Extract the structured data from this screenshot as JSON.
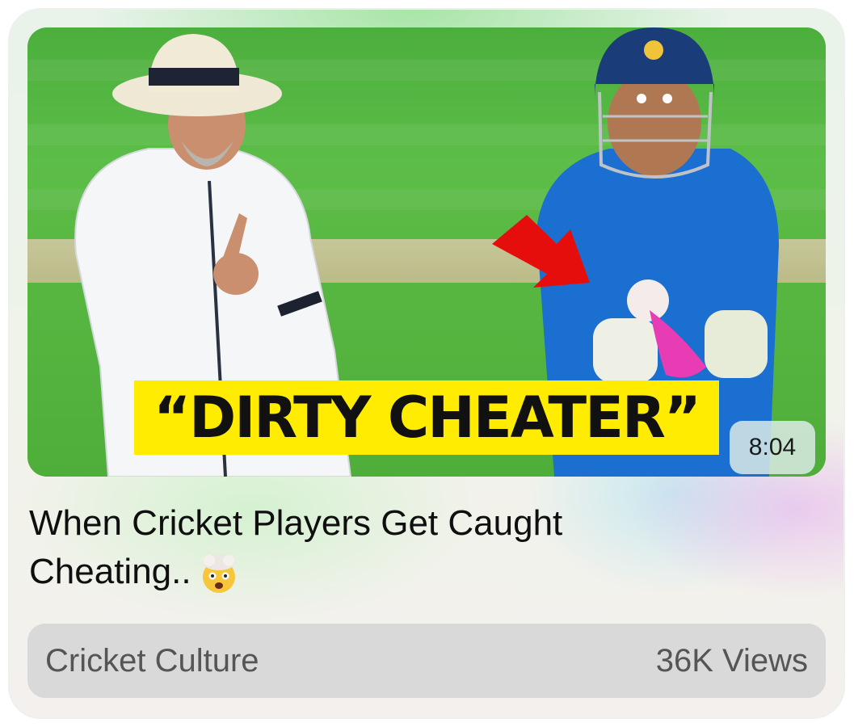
{
  "video": {
    "thumbnail_text": "“DIRTY CHEATER”",
    "duration": "8:04",
    "title": "When Cricket Players Get Caught Cheating..",
    "title_emoji": "exploding-head-emoji",
    "channel": "Cricket Culture",
    "views": "36K Views"
  },
  "colors": {
    "headline_bg": "#ffec00",
    "arrow": "#e60d0d",
    "footer_bg": "#d9d9d9"
  }
}
